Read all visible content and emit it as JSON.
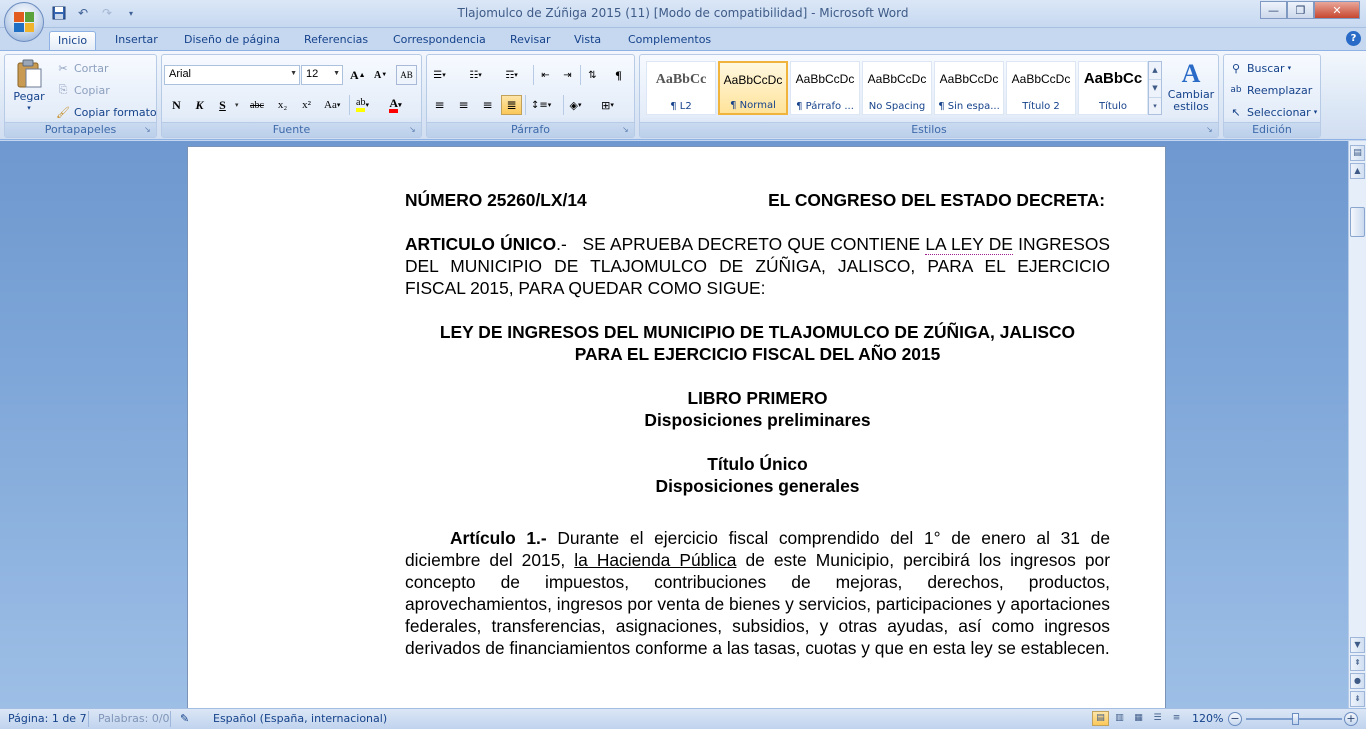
{
  "window": {
    "title": "Tlajomulco de Zúñiga 2015 (11) [Modo de compatibilidad] - Microsoft Word",
    "controls": {
      "minimize": "—",
      "maximize": "❐",
      "close": "✕"
    }
  },
  "tabs": [
    "Inicio",
    "Insertar",
    "Diseño de página",
    "Referencias",
    "Correspondencia",
    "Revisar",
    "Vista",
    "Complementos"
  ],
  "help": "?",
  "clipboard": {
    "label": "Portapapeles",
    "paste": "Pegar",
    "cut": "Cortar",
    "copy": "Copiar",
    "format_painter": "Copiar formato"
  },
  "font": {
    "label": "Fuente",
    "family": "Arial",
    "size": "12",
    "grow": "A",
    "shrink": "A",
    "bold": "N",
    "italic": "K",
    "underline": "S",
    "strike": "abc",
    "subscript": "x₂",
    "superscript": "x²",
    "case": "Aa",
    "clear": "AB"
  },
  "paragraph": {
    "label": "Párrafo",
    "show_marks": "¶"
  },
  "styles": {
    "label": "Estilos",
    "items": [
      {
        "sample": "AaBbCc",
        "name": "¶ L2"
      },
      {
        "sample": "AaBbCcDc",
        "name": "¶ Normal"
      },
      {
        "sample": "AaBbCcDc",
        "name": "¶ Párrafo ..."
      },
      {
        "sample": "AaBbCcDc",
        "name": "No Spacing"
      },
      {
        "sample": "AaBbCcDc",
        "name": "¶ Sin espa..."
      },
      {
        "sample": "AaBbCcDc",
        "name": "Título 2"
      },
      {
        "sample": "AaBbCc",
        "name": "Título"
      }
    ],
    "change": "Cambiar estilos"
  },
  "editing": {
    "label": "Edición",
    "find": "Buscar",
    "replace": "Reemplazar",
    "select": "Seleccionar"
  },
  "document": {
    "number": "NÚMERO 25260/LX/14",
    "decree": "EL CONGRESO DEL ESTADO DECRETA:",
    "article_label": "ARTICULO ÚNICO",
    "article_sep": ".-",
    "article_text_1": "SE APRUEBA DECRETO QUE CONTIENE",
    "article_link": "LA LEY DE",
    "article_text_2": "INGRESOS DEL MUNICIPIO DE TLAJOMULCO DE ZÚÑIGA, JALISCO, PARA EL EJERCICIO FISCAL 2015,  PARA QUEDAR COMO SIGUE:",
    "law_title_1": "LEY DE INGRESOS DEL MUNICIPIO DE TLAJOMULCO DE ZÚÑIGA, JALISCO",
    "law_title_2": "PARA EL EJERCICIO FISCAL DEL AÑO 2015",
    "book": "LIBRO PRIMERO",
    "book_sub": "Disposiciones preliminares",
    "title": "Título Único",
    "title_sub": "Disposiciones generales",
    "art1_label": "Artículo 1.-",
    "art1_text_1": "Durante el ejercicio fiscal comprendido del 1° de enero al 31 de diciembre del 2015,",
    "art1_link": "la Hacienda Pública",
    "art1_text_2": "de este Municipio, percibirá los ingresos por concepto de impuestos, contribuciones de mejoras, derechos, productos, aprovechamientos, ingresos por venta de bienes y servicios, participaciones y aportaciones federales, transferencias, asignaciones, subsidios,  y otras ayudas, así  como ingresos  derivados de financiamientos  conforme a las tasas, cuotas y que en esta ley se establecen."
  },
  "status": {
    "page": "Página: 1 de 7",
    "words": "Palabras: 0/0",
    "language": "Español (España, internacional)",
    "zoom": "120%",
    "zoom_out": "−",
    "zoom_in": "+"
  },
  "colors": {
    "accent": "#15428b",
    "ribbon": "#dde8f6",
    "highlight": "#fbc859",
    "font_color": "#ff0000"
  }
}
